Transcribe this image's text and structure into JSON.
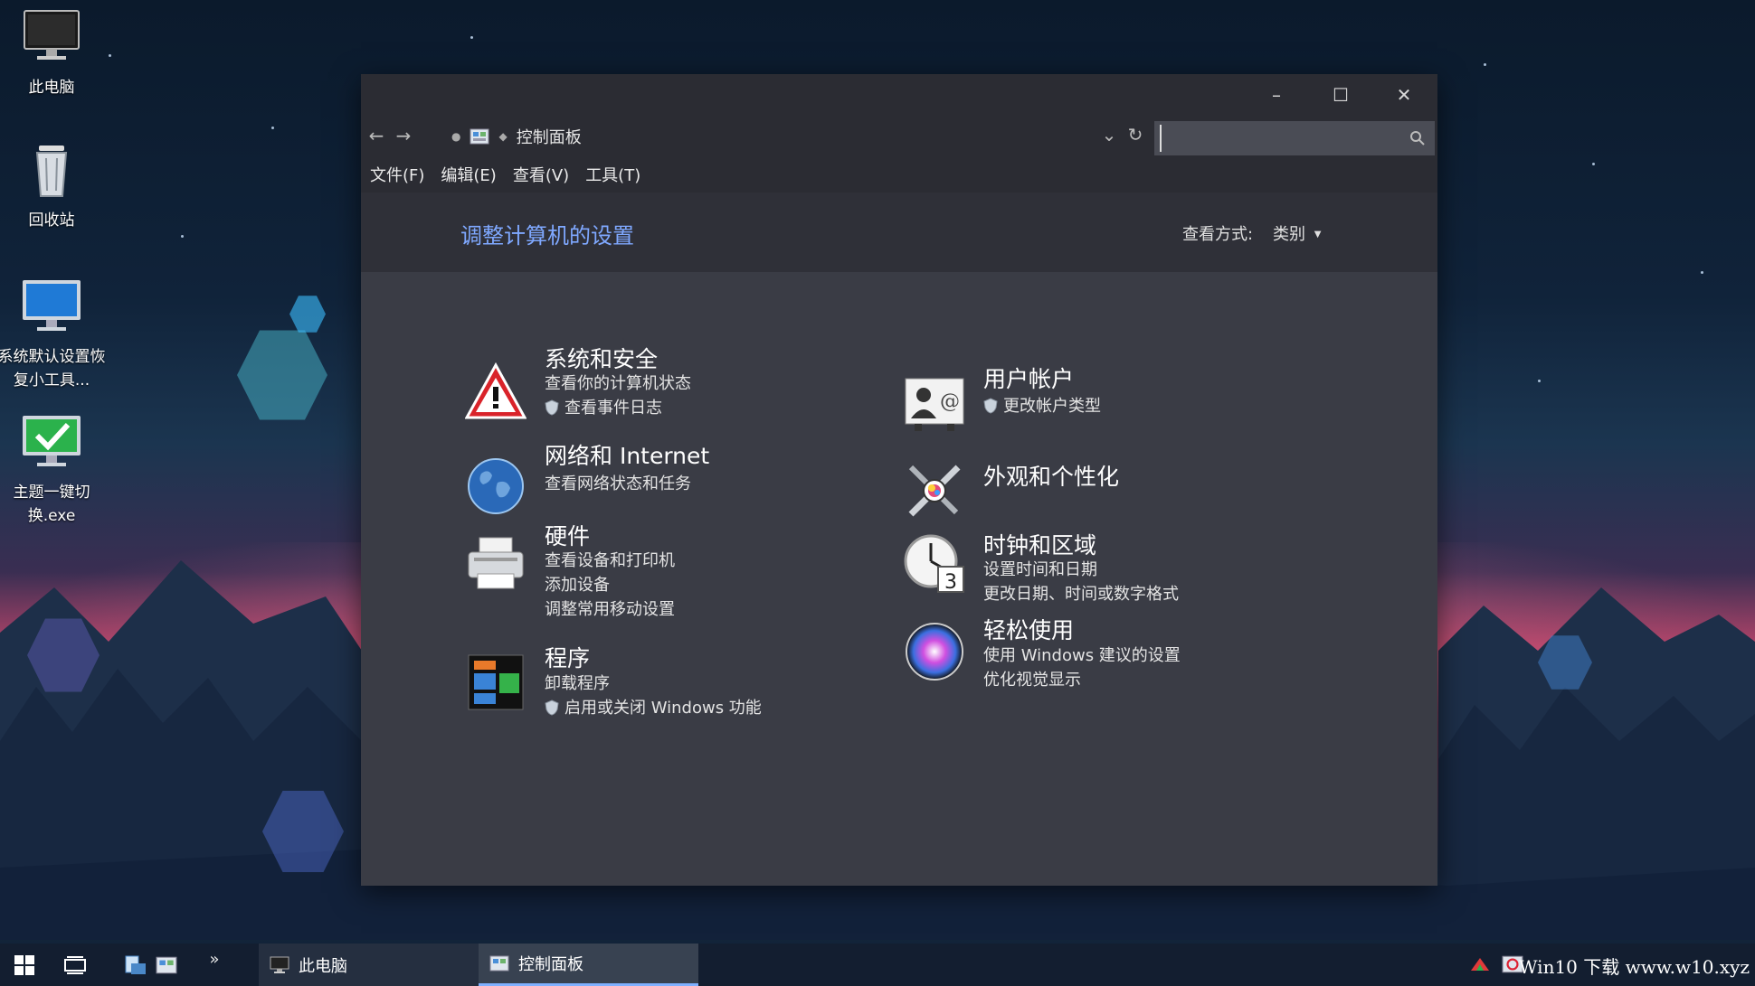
{
  "desktop": {
    "icons": [
      {
        "label": "此电脑",
        "icon": "computer-icon"
      },
      {
        "label": "回收站",
        "icon": "recycle-bin-icon"
      },
      {
        "label": "系统默认设置恢复小工具...",
        "icon": "monitor-icon"
      },
      {
        "label": "主题一键切换.exe",
        "icon": "checkmark-monitor-icon"
      }
    ]
  },
  "window": {
    "titlebar": {
      "minimize": "–",
      "maximize": "☐",
      "close": "✕"
    },
    "address": {
      "back": "←",
      "forward": "→",
      "crumb": "控制面板",
      "dropdown": "⌄",
      "refresh": "↻"
    },
    "search": {
      "placeholder": "",
      "value": ""
    },
    "menu": [
      "文件(F)",
      "编辑(E)",
      "查看(V)",
      "工具(T)"
    ],
    "header": {
      "title": "调整计算机的设置",
      "view_label": "查看方式:",
      "view_value": "类别"
    },
    "categories_left": [
      {
        "title": "系统和安全",
        "icon": "warning-icon",
        "links": [
          "查看你的计算机状态",
          "查看事件日志"
        ],
        "shield_on": [
          false,
          true
        ]
      },
      {
        "title": "网络和 Internet",
        "icon": "globe-icon",
        "links": [
          "查看网络状态和任务"
        ],
        "shield_on": [
          false
        ]
      },
      {
        "title": "硬件",
        "icon": "printer-icon",
        "links": [
          "查看设备和打印机",
          "添加设备",
          "调整常用移动设置"
        ],
        "shield_on": [
          false,
          false,
          false
        ]
      },
      {
        "title": "程序",
        "icon": "programs-icon",
        "links": [
          "卸载程序",
          "启用或关闭 Windows 功能"
        ],
        "shield_on": [
          false,
          true
        ]
      }
    ],
    "categories_right": [
      {
        "title": "用户帐户",
        "icon": "user-accounts-icon",
        "links": [
          "更改帐户类型"
        ],
        "shield_on": [
          true
        ]
      },
      {
        "title": "外观和个性化",
        "icon": "personalization-icon",
        "links": [],
        "shield_on": []
      },
      {
        "title": "时钟和区域",
        "icon": "clock-icon",
        "links": [
          "设置时间和日期",
          "更改日期、时间或数字格式"
        ],
        "shield_on": [
          false,
          false
        ]
      },
      {
        "title": "轻松使用",
        "icon": "ease-of-access-icon",
        "links": [
          "使用 Windows 建议的设置",
          "优化视觉显示"
        ],
        "shield_on": [
          false,
          false
        ]
      }
    ]
  },
  "taskbar": {
    "start": "start-icon",
    "task_view": "task-view-icon",
    "overflow": "»",
    "apps": [
      {
        "label": "此电脑",
        "icon": "computer-icon"
      },
      {
        "label": "控制面板",
        "icon": "control-panel-icon"
      }
    ],
    "tray_text": "Win10 下载 www.w10.xyz"
  }
}
